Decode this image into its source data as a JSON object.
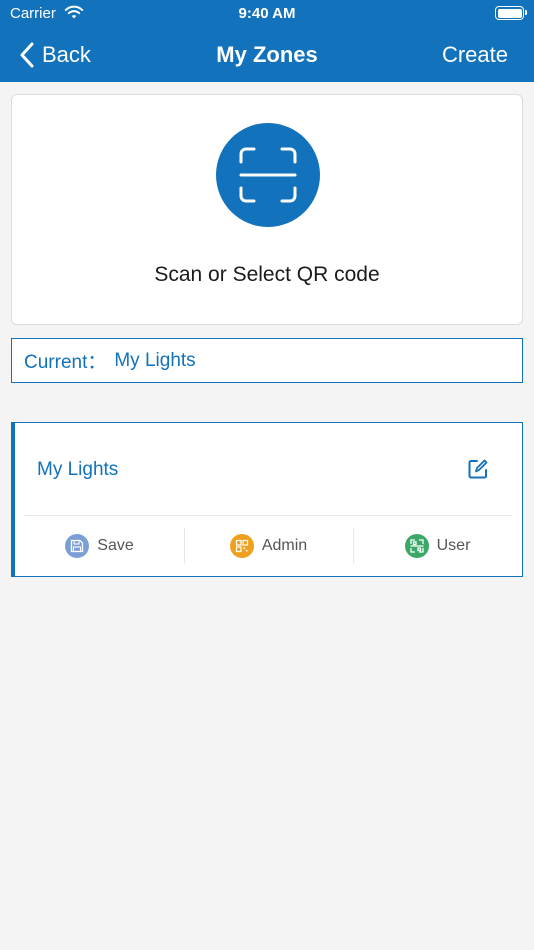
{
  "status_bar": {
    "carrier": "Carrier",
    "time": "9:40 AM"
  },
  "nav": {
    "back_label": "Back",
    "title": "My Zones",
    "create_label": "Create"
  },
  "scan": {
    "label": "Scan or Select QR code",
    "icon": "qr-scan-icon"
  },
  "current": {
    "label": "Current：",
    "value": "My Lights"
  },
  "zone": {
    "name": "My Lights",
    "actions": [
      {
        "label": "Save",
        "icon": "save-icon",
        "color": "#7b9fd4"
      },
      {
        "label": "Admin",
        "icon": "qr-code-icon",
        "color": "#f0a020"
      },
      {
        "label": "User",
        "icon": "qr-scan-icon",
        "color": "#3aa866"
      }
    ]
  },
  "colors": {
    "primary": "#1272bb",
    "background": "#f4f4f4"
  }
}
